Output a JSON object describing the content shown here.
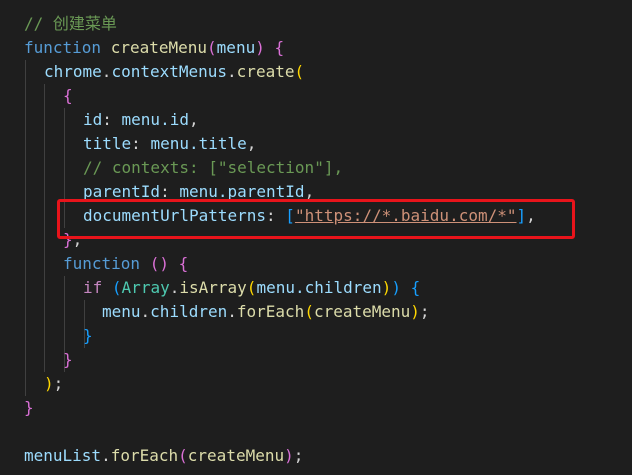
{
  "colors": {
    "background": "#1e1e1e",
    "comment": "#6a9955",
    "keyword": "#569cd6",
    "function": "#dcdcaa",
    "variable": "#9cdcfe",
    "class": "#4ec9b0",
    "string": "#ce9178",
    "punctuation": "#d4d4d4",
    "bracket_gold": "#ffd700",
    "bracket_purple": "#da70d6",
    "bracket_blue": "#179fff",
    "highlight": "#e8141b"
  },
  "code": {
    "comment_create_menu": "// 创建菜单",
    "kw_function": "function",
    "fn_createMenu": "createMenu",
    "param_menu": "menu",
    "var_chrome": "chrome",
    "prop_contextMenus": "contextMenus",
    "fn_create": "create",
    "key_id": "id",
    "val_menu_id": "menu.id",
    "key_title": "title",
    "val_menu_title": "menu.title",
    "comment_contexts": "// contexts: [\"selection\"],",
    "key_parentId": "parentId",
    "val_menu_parentId": "menu.parentId",
    "key_documentUrlPatterns": "documentUrlPatterns",
    "string_url": "\"https://*.baidu.com/*\"",
    "kw_if": "if",
    "class_Array": "Array",
    "fn_isArray": "isArray",
    "val_menu_children": "menu.children",
    "val_menu": "menu",
    "prop_children": "children",
    "fn_forEach": "forEach",
    "var_menuList": "menuList"
  }
}
